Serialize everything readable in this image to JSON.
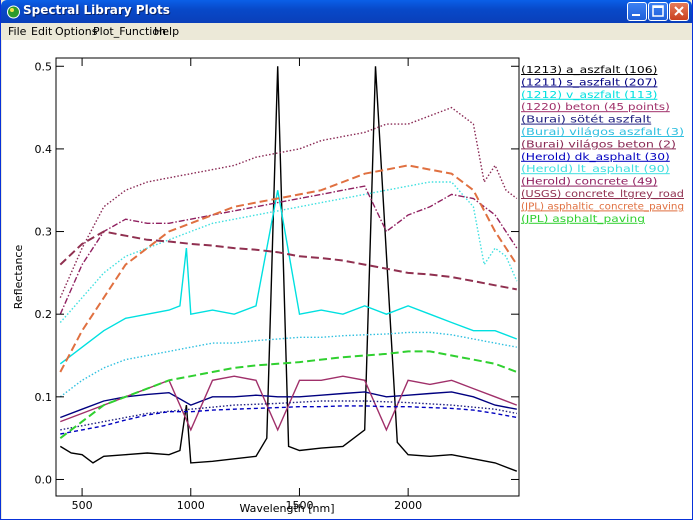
{
  "window": {
    "title": "Spectral Library Plots"
  },
  "menu": {
    "file": "File",
    "edit": "Edit",
    "options": "Options",
    "plot_function": "Plot_Function",
    "help": "Help"
  },
  "colors": {
    "titlebar": "#0a5fe8",
    "plot_background": "#ffffff"
  },
  "chart_data": {
    "type": "line",
    "xlabel": "Wavelength [nm]",
    "ylabel": "Reflectance",
    "xlim": [
      380,
      2510
    ],
    "ylim": [
      -0.02,
      0.51
    ],
    "x_ticks": [
      500,
      1000,
      1500,
      2000
    ],
    "x_tick_labels": [
      "500",
      "1000",
      "1500",
      "2000"
    ],
    "y_ticks": [
      0.0,
      0.1,
      0.2,
      0.3,
      0.4,
      0.5
    ],
    "y_tick_labels": [
      "0.0",
      "0.1",
      "0.2",
      "0.3",
      "0.4",
      "0.5"
    ],
    "grid": false,
    "legend_position": "right",
    "series": [
      {
        "name": "(1213) a_aszfalt (106)",
        "color": "#000000",
        "style": "solid",
        "x": [
          400,
          450,
          500,
          550,
          600,
          700,
          800,
          900,
          950,
          980,
          1000,
          1100,
          1200,
          1300,
          1350,
          1400,
          1450,
          1500,
          1600,
          1700,
          1800,
          1850,
          1950,
          2000,
          2100,
          2200,
          2300,
          2400,
          2500
        ],
        "y": [
          0.04,
          0.032,
          0.03,
          0.02,
          0.028,
          0.03,
          0.032,
          0.03,
          0.035,
          0.09,
          0.02,
          0.022,
          0.025,
          0.028,
          0.05,
          0.5,
          0.04,
          0.035,
          0.038,
          0.04,
          0.06,
          0.5,
          0.045,
          0.03,
          0.028,
          0.03,
          0.025,
          0.02,
          0.01
        ]
      },
      {
        "name": "(1211) s_aszfalt (207)",
        "color": "#000080",
        "style": "solid",
        "x": [
          400,
          500,
          600,
          700,
          800,
          900,
          1000,
          1100,
          1200,
          1300,
          1400,
          1500,
          1600,
          1700,
          1800,
          1900,
          2000,
          2100,
          2200,
          2300,
          2400,
          2500
        ],
        "y": [
          0.075,
          0.085,
          0.095,
          0.1,
          0.103,
          0.105,
          0.09,
          0.1,
          0.1,
          0.102,
          0.1,
          0.1,
          0.102,
          0.104,
          0.106,
          0.1,
          0.102,
          0.104,
          0.106,
          0.1,
          0.09,
          0.085
        ]
      },
      {
        "name": "(1212) v_aszfalt (113)",
        "color": "#00e0e0",
        "style": "solid",
        "x": [
          400,
          500,
          600,
          700,
          800,
          900,
          950,
          980,
          1000,
          1100,
          1200,
          1300,
          1400,
          1500,
          1600,
          1700,
          1800,
          1900,
          2000,
          2100,
          2200,
          2300,
          2400,
          2500
        ],
        "y": [
          0.14,
          0.16,
          0.18,
          0.195,
          0.2,
          0.205,
          0.21,
          0.28,
          0.2,
          0.205,
          0.2,
          0.21,
          0.35,
          0.2,
          0.205,
          0.2,
          0.21,
          0.2,
          0.21,
          0.2,
          0.19,
          0.18,
          0.18,
          0.17
        ]
      },
      {
        "name": "(1220) beton (45 points)",
        "color": "#a0306a",
        "style": "solid",
        "x": [
          400,
          500,
          600,
          700,
          800,
          900,
          1000,
          1100,
          1200,
          1300,
          1400,
          1500,
          1600,
          1700,
          1800,
          1900,
          2000,
          2100,
          2200,
          2300,
          2400,
          2500
        ],
        "y": [
          0.07,
          0.08,
          0.09,
          0.1,
          0.11,
          0.12,
          0.06,
          0.12,
          0.125,
          0.12,
          0.06,
          0.12,
          0.12,
          0.125,
          0.12,
          0.06,
          0.12,
          0.115,
          0.12,
          0.11,
          0.1,
          0.09
        ]
      },
      {
        "name": "(Burai) sötét aszfalt",
        "color": "#202080",
        "style": "dotted",
        "x": [
          400,
          600,
          800,
          1000,
          1200,
          1400,
          1600,
          1800,
          2000,
          2200,
          2400,
          2500
        ],
        "y": [
          0.06,
          0.07,
          0.08,
          0.085,
          0.09,
          0.092,
          0.095,
          0.095,
          0.093,
          0.09,
          0.085,
          0.08
        ]
      },
      {
        "name": "(Burai) világos aszfalt (3)",
        "color": "#30c0e0",
        "style": "dotted",
        "x": [
          400,
          500,
          600,
          700,
          800,
          900,
          1000,
          1100,
          1200,
          1300,
          1400,
          1500,
          1600,
          1700,
          1800,
          1900,
          2000,
          2100,
          2200,
          2300,
          2400,
          2500
        ],
        "y": [
          0.1,
          0.12,
          0.135,
          0.145,
          0.15,
          0.155,
          0.16,
          0.165,
          0.165,
          0.168,
          0.17,
          0.172,
          0.172,
          0.174,
          0.175,
          0.176,
          0.178,
          0.178,
          0.175,
          0.17,
          0.165,
          0.16
        ]
      },
      {
        "name": "(Burai) világos beton (2)",
        "color": "#8a2a55",
        "style": "dotted",
        "x": [
          400,
          500,
          600,
          700,
          800,
          900,
          1000,
          1100,
          1200,
          1300,
          1400,
          1500,
          1600,
          1700,
          1800,
          1900,
          2000,
          2100,
          2200,
          2300,
          2350,
          2400,
          2450,
          2500
        ],
        "y": [
          0.22,
          0.28,
          0.33,
          0.35,
          0.36,
          0.365,
          0.37,
          0.375,
          0.38,
          0.39,
          0.395,
          0.4,
          0.41,
          0.415,
          0.42,
          0.43,
          0.43,
          0.44,
          0.45,
          0.43,
          0.36,
          0.38,
          0.35,
          0.34
        ]
      },
      {
        "name": "(Herold) dk_asphalt (30)",
        "color": "#0000c0",
        "style": "dashed",
        "x": [
          400,
          500,
          600,
          700,
          800,
          900,
          1000,
          1100,
          1200,
          1300,
          1400,
          1500,
          1600,
          1700,
          1800,
          1900,
          2000,
          2100,
          2200,
          2300,
          2400,
          2500
        ],
        "y": [
          0.055,
          0.06,
          0.065,
          0.072,
          0.078,
          0.082,
          0.082,
          0.084,
          0.085,
          0.086,
          0.087,
          0.088,
          0.088,
          0.089,
          0.089,
          0.088,
          0.088,
          0.087,
          0.086,
          0.084,
          0.08,
          0.075
        ]
      },
      {
        "name": "(Herold) lt_asphalt (90)",
        "color": "#40e0e0",
        "style": "dotted",
        "x": [
          400,
          500,
          600,
          700,
          800,
          900,
          1000,
          1100,
          1200,
          1300,
          1400,
          1500,
          1600,
          1700,
          1800,
          1900,
          2000,
          2100,
          2200,
          2300,
          2350,
          2400,
          2450,
          2500
        ],
        "y": [
          0.19,
          0.22,
          0.25,
          0.27,
          0.28,
          0.29,
          0.3,
          0.31,
          0.315,
          0.32,
          0.325,
          0.33,
          0.335,
          0.34,
          0.345,
          0.35,
          0.355,
          0.36,
          0.36,
          0.33,
          0.26,
          0.28,
          0.27,
          0.24
        ]
      },
      {
        "name": "(Herold) concrete (49)",
        "color": "#902060",
        "style": "dashdot",
        "x": [
          400,
          500,
          600,
          700,
          800,
          900,
          1000,
          1100,
          1200,
          1300,
          1400,
          1500,
          1600,
          1700,
          1800,
          1900,
          2000,
          2100,
          2200,
          2300,
          2400,
          2500
        ],
        "y": [
          0.2,
          0.26,
          0.3,
          0.315,
          0.31,
          0.31,
          0.315,
          0.32,
          0.325,
          0.33,
          0.335,
          0.34,
          0.345,
          0.35,
          0.355,
          0.3,
          0.32,
          0.33,
          0.345,
          0.34,
          0.32,
          0.28
        ]
      },
      {
        "name": "(USGS) concrete_ltgrey_road",
        "color": "#903050",
        "style": "longdash",
        "x": [
          400,
          500,
          600,
          700,
          800,
          900,
          1000,
          1100,
          1200,
          1300,
          1400,
          1500,
          1600,
          1700,
          1800,
          1900,
          2000,
          2100,
          2200,
          2300,
          2400,
          2500
        ],
        "y": [
          0.26,
          0.285,
          0.3,
          0.295,
          0.29,
          0.288,
          0.285,
          0.283,
          0.28,
          0.278,
          0.275,
          0.27,
          0.268,
          0.265,
          0.26,
          0.255,
          0.25,
          0.248,
          0.245,
          0.24,
          0.235,
          0.23
        ]
      },
      {
        "name": "(JPL) asphaltic_concrete_paving",
        "color": "#e07040",
        "style": "longdash",
        "x": [
          400,
          500,
          600,
          700,
          800,
          900,
          1000,
          1100,
          1200,
          1300,
          1400,
          1500,
          1600,
          1700,
          1800,
          1900,
          2000,
          2100,
          2200,
          2300,
          2400,
          2500
        ],
        "y": [
          0.13,
          0.18,
          0.22,
          0.26,
          0.28,
          0.3,
          0.31,
          0.32,
          0.33,
          0.335,
          0.34,
          0.345,
          0.35,
          0.36,
          0.37,
          0.375,
          0.38,
          0.375,
          0.37,
          0.35,
          0.3,
          0.26
        ]
      },
      {
        "name": "(JPL) asphalt_paving",
        "color": "#30d030",
        "style": "longdash",
        "x": [
          400,
          500,
          600,
          700,
          800,
          900,
          1000,
          1100,
          1200,
          1300,
          1400,
          1500,
          1600,
          1700,
          1800,
          1900,
          2000,
          2100,
          2200,
          2300,
          2400,
          2500
        ],
        "y": [
          0.05,
          0.07,
          0.09,
          0.1,
          0.11,
          0.12,
          0.125,
          0.13,
          0.135,
          0.138,
          0.14,
          0.142,
          0.145,
          0.148,
          0.15,
          0.152,
          0.155,
          0.155,
          0.15,
          0.145,
          0.14,
          0.13
        ]
      }
    ]
  }
}
